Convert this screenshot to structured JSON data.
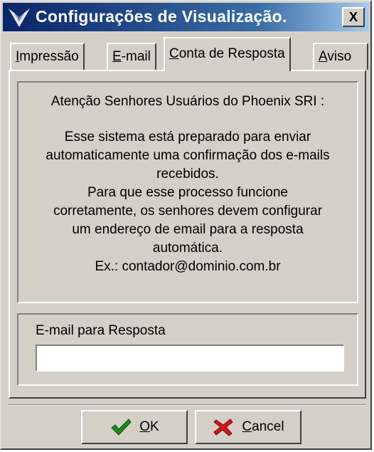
{
  "window": {
    "title": "Configurações de Visualização.",
    "close_label": "X"
  },
  "tabs": [
    {
      "accel": "I",
      "rest": "mpressão"
    },
    {
      "accel": "E",
      "rest": "-mail"
    },
    {
      "accel": "C",
      "rest": "onta de Resposta"
    },
    {
      "accel": "A",
      "rest": "viso"
    }
  ],
  "active_tab": "Conta de Resposta",
  "notice": {
    "title": "Atenção Senhores Usuários do Phoenix SRI :",
    "body": "Esse sistema está preparado para enviar\nautomaticamente uma confirmação dos e-mails\nrecebidos.\nPara que esse processo funcione\ncorretamente, os senhores devem configurar\num endereço de email para a resposta\nautomática.\nEx.: contador@dominio.com.br"
  },
  "reply_email": {
    "label": "E-mail para Resposta",
    "value": ""
  },
  "buttons": {
    "ok": {
      "accel": "O",
      "rest": "K"
    },
    "cancel": {
      "accel": "C",
      "rest": "ancel"
    }
  }
}
